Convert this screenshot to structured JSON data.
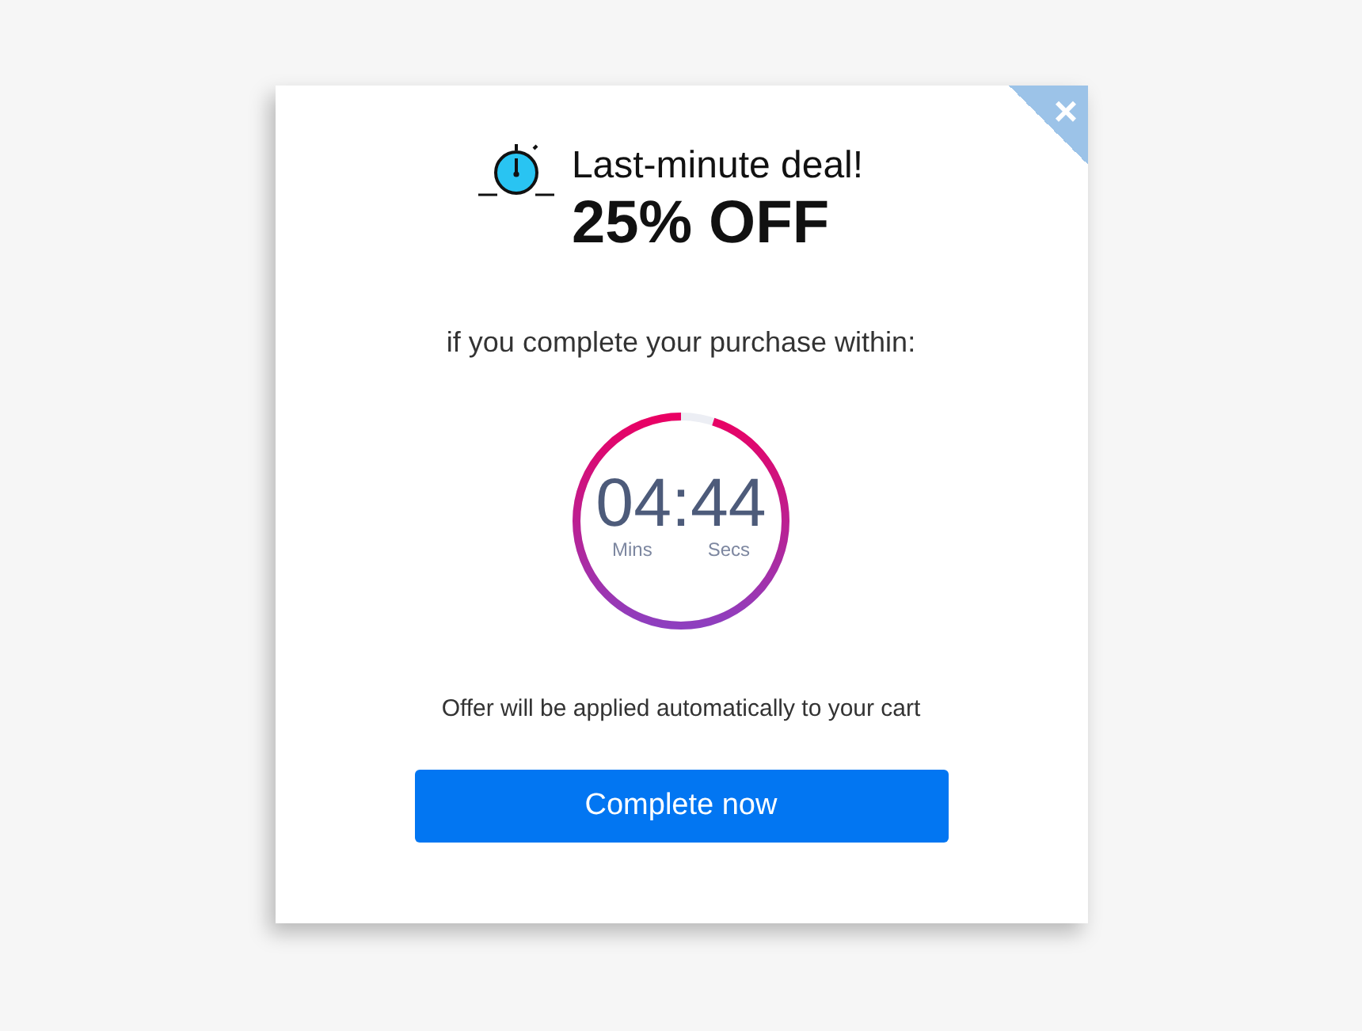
{
  "close": "×",
  "headline": "Last-minute deal!",
  "offer": "25% OFF",
  "subtitle": "if you complete your purchase within:",
  "timer": {
    "minutes": "04",
    "separator": ":",
    "seconds": "44",
    "minutes_label": "Mins",
    "seconds_label": "Secs",
    "level": 0.95
  },
  "note": "Offer will be applied automatically to your cart",
  "button": "Complete now"
}
